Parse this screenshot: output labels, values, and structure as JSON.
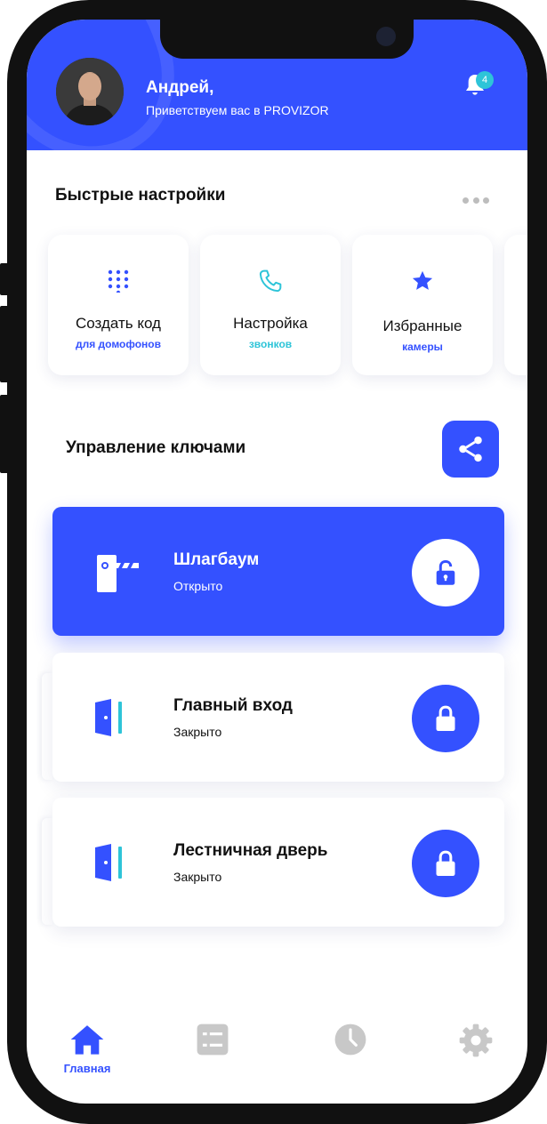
{
  "header": {
    "user_name": "Андрей,",
    "greeting": "Приветствуем вас в PROVIZOR",
    "notification_count": "4"
  },
  "quick_settings": {
    "title": "Быстрые настройки",
    "cards": [
      {
        "title": "Создать код",
        "subtitle": "для домофонов",
        "icon": "dialpad-icon",
        "subtitle_color": "#3451ff"
      },
      {
        "title": "Настройка",
        "subtitle": "звонков",
        "icon": "phone-icon",
        "subtitle_color": "#2ec4d8"
      },
      {
        "title": "Избранные",
        "subtitle": "камеры",
        "icon": "star-icon",
        "subtitle_color": "#3451ff"
      }
    ]
  },
  "keys": {
    "title": "Управление ключами",
    "items": [
      {
        "name": "Шлагбаум",
        "status": "Открыто",
        "icon": "barrier-icon",
        "lock": "unlocked"
      },
      {
        "name": "Главный вход",
        "status": "Закрыто",
        "icon": "door-icon",
        "lock": "locked"
      },
      {
        "name": "Лестничная дверь",
        "status": "Закрыто",
        "icon": "door-icon",
        "lock": "locked"
      }
    ]
  },
  "tabbar": {
    "tabs": [
      {
        "label": "Главная",
        "icon": "home-icon",
        "active": true
      },
      {
        "label": "",
        "icon": "list-icon",
        "active": false
      },
      {
        "label": "",
        "icon": "clock-icon",
        "active": false
      },
      {
        "label": "",
        "icon": "gear-icon",
        "active": false
      }
    ]
  },
  "colors": {
    "accent": "#3451ff",
    "teal": "#2ec4d8",
    "inactive_icon": "#c8c8c8"
  }
}
